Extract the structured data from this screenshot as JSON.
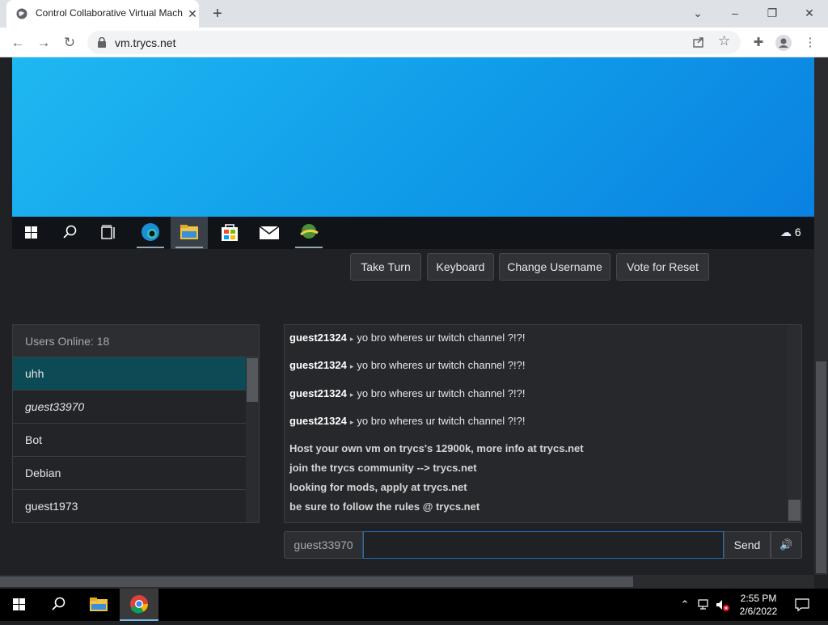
{
  "browser": {
    "tab_title": "Control Collaborative Virtual Machines",
    "url": "vm.trycs.net"
  },
  "vm": {
    "weather_temp": "6",
    "taskbar_icons": [
      "windows-start-icon",
      "search-icon",
      "task-view-icon",
      "edge-icon",
      "file-explorer-icon",
      "store-icon",
      "mail-icon",
      "network-app-icon"
    ]
  },
  "controls": {
    "take_turn": "Take Turn",
    "keyboard": "Keyboard",
    "change_username": "Change Username",
    "vote_reset": "Vote for Reset"
  },
  "users": {
    "header": "Users Online: 18",
    "list": [
      {
        "name": "uhh",
        "selected": true,
        "italic": false
      },
      {
        "name": "guest33970",
        "selected": false,
        "italic": true
      },
      {
        "name": "Bot",
        "selected": false,
        "italic": false
      },
      {
        "name": "Debian",
        "selected": false,
        "italic": false
      },
      {
        "name": "guest1973",
        "selected": false,
        "italic": false
      }
    ]
  },
  "chat": {
    "messages": [
      {
        "user": "guest21324",
        "text": "yo bro wheres ur twitch channel ?!?!"
      },
      {
        "user": "guest21324",
        "text": "yo bro wheres ur twitch channel ?!?!"
      },
      {
        "user": "guest21324",
        "text": "yo bro wheres ur twitch channel ?!?!"
      },
      {
        "user": "guest21324",
        "text": "yo bro wheres ur twitch channel ?!?!"
      }
    ],
    "notices": [
      "Host your own vm on trycs's 12900k, more info at trycs.net",
      "join the trycs community --> trycs.net",
      "looking for mods, apply at trycs.net",
      "be sure to follow the rules @ trycs.net"
    ],
    "input_username": "guest33970",
    "input_value": "",
    "send_label": "Send"
  },
  "os": {
    "time": "2:55 PM",
    "date": "2/6/2022"
  }
}
